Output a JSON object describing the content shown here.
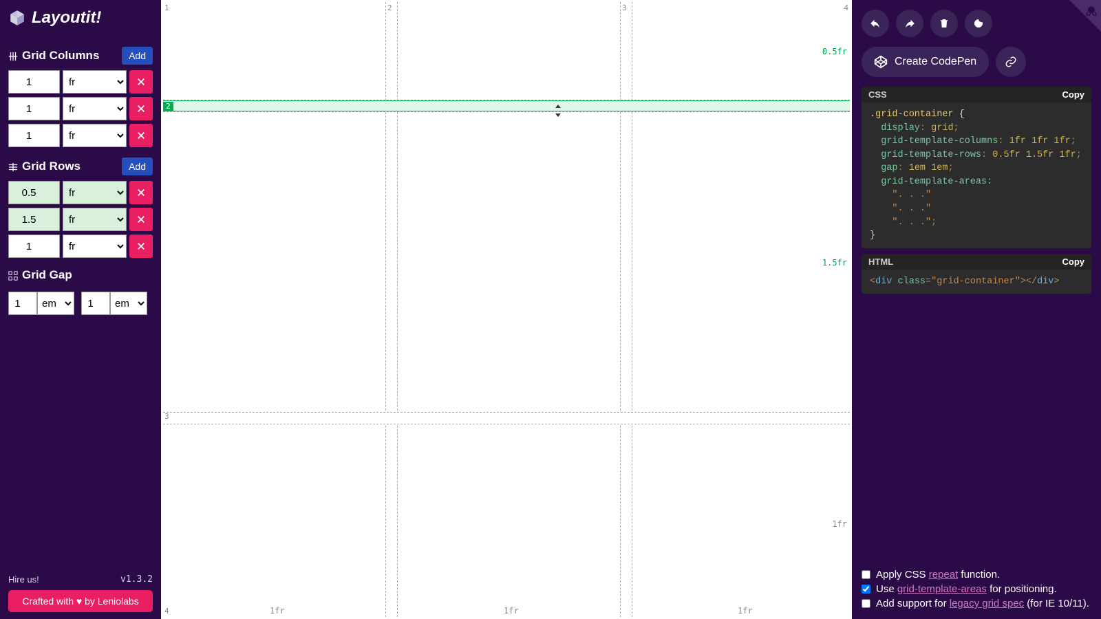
{
  "app": {
    "title": "Layoutit!"
  },
  "columns": {
    "title": "Grid Columns",
    "add": "Add",
    "tracks": [
      {
        "value": "1",
        "unit": "fr"
      },
      {
        "value": "1",
        "unit": "fr"
      },
      {
        "value": "1",
        "unit": "fr"
      }
    ]
  },
  "rows": {
    "title": "Grid Rows",
    "add": "Add",
    "tracks": [
      {
        "value": "0.5",
        "unit": "fr",
        "highlight": true
      },
      {
        "value": "1.5",
        "unit": "fr",
        "highlight": true
      },
      {
        "value": "1",
        "unit": "fr"
      }
    ]
  },
  "gap": {
    "title": "Grid Gap",
    "row": {
      "value": "1",
      "unit": "em"
    },
    "col": {
      "value": "1",
      "unit": "em"
    }
  },
  "footer": {
    "hire": "Hire us!",
    "version": "v1.3.2",
    "crafted": "Crafted with ♥ by Leniolabs"
  },
  "canvas": {
    "col_nums": [
      "1",
      "2",
      "3",
      "4"
    ],
    "row_nums": [
      "1",
      "2",
      "3",
      "4"
    ],
    "col_fr": [
      "1fr",
      "1fr",
      "1fr"
    ],
    "row_fr": [
      "0.5fr",
      "1.5fr",
      "1fr"
    ]
  },
  "codepen": {
    "label": "Create CodePen"
  },
  "css": {
    "title": "CSS",
    "copy": "Copy",
    "selector": ".grid-container",
    "display": "grid",
    "cols": "1fr 1fr 1fr",
    "rows": "0.5fr 1.5fr 1fr",
    "gap": "1em 1em",
    "areas_label": "grid-template-areas:",
    "area1": "\". . .\"",
    "area2": "\". . .\"",
    "area3": "\". . .\""
  },
  "html": {
    "title": "HTML",
    "copy": "Copy",
    "tag": "div",
    "cls": "grid-container"
  },
  "options": {
    "repeat_pre": "Apply CSS ",
    "repeat_link": "repeat",
    "repeat_post": " function.",
    "areas_pre": "Use ",
    "areas_link": "grid-template-areas",
    "areas_post": " for positioning.",
    "legacy_pre": "Add support for ",
    "legacy_link": "legacy grid spec",
    "legacy_post": " (for IE 10/11).",
    "repeat_checked": false,
    "areas_checked": true,
    "legacy_checked": false
  }
}
